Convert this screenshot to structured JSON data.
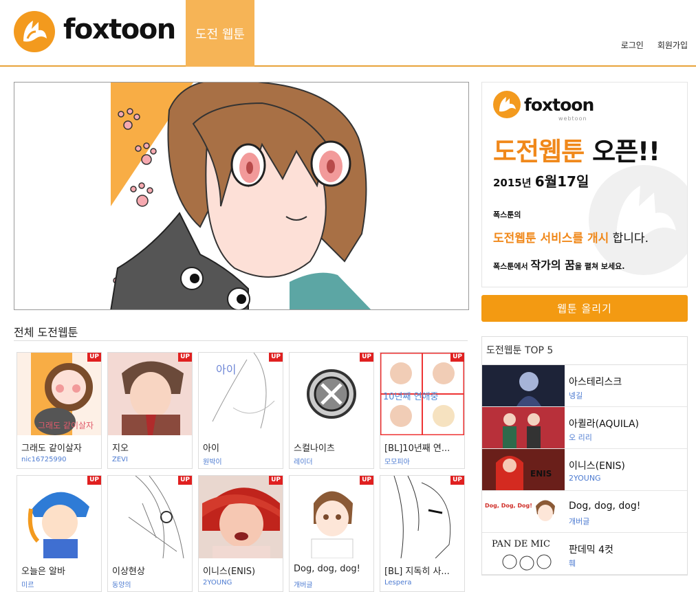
{
  "header": {
    "logo_text": "foxtoon",
    "nav_tab": "도전 웹툰",
    "login": "로그인",
    "signup": "회원가입"
  },
  "section_title": "전체 도전웹툰",
  "up_badge": "UP",
  "webtoons": [
    {
      "title": "그래도 같이살자",
      "author": "nic16725990",
      "thumb_text": "그래도 같이살자"
    },
    {
      "title": "지오",
      "author": "ZEVI"
    },
    {
      "title": "아이",
      "author": "원박이",
      "thumb_text": "아이"
    },
    {
      "title": "스컬나이츠",
      "author": "레이더"
    },
    {
      "title": "[BL]10년째 연...",
      "author": "모모피아",
      "thumb_text": "10년째 연애중"
    },
    {
      "title": "오늘은 알바",
      "author": "미르"
    },
    {
      "title": "이상현상",
      "author": "동양의"
    },
    {
      "title": "이니스(ENIS)",
      "author": "2YOUNG"
    },
    {
      "title": "Dog, dog, dog!",
      "author": "개버글"
    },
    {
      "title": "[BL] 지독히 사...",
      "author": "Lespera"
    }
  ],
  "promo": {
    "logo_text": "foxtoon",
    "logo_sub": "webtoon",
    "headline_orange": "도전웹툰",
    "headline_black": "오픈!!",
    "date_year": "2015년",
    "date_day": "6월17일",
    "line1": "폭스툰의",
    "line2_orange": "도전웹툰 서비스를 개시",
    "line2_black": "합니다.",
    "line3_a": "폭스툰에서",
    "line3_b": "작가의 꿈",
    "line3_c": "을 펼쳐 보세요."
  },
  "upload_button": "웹툰 올리기",
  "top5": {
    "title": "도전웹툰 TOP 5",
    "items": [
      {
        "title": "아스테리스크",
        "author": "넹길"
      },
      {
        "title": "아퀼라(AQUILA)",
        "author": "오 리리"
      },
      {
        "title": "이니스(ENIS)",
        "author": "2YOUNG"
      },
      {
        "title": "Dog, dog, dog!",
        "author": "개버글",
        "thumb_text": "Dog, Dog, Dog!"
      },
      {
        "title": "판데믹 4컷",
        "author": "훼",
        "thumb_text": "PAN DE MIC"
      }
    ]
  },
  "colors": {
    "brand_orange": "#f39a12",
    "tab_orange": "#f6b456",
    "up_red": "#e02020",
    "author_blue": "#4d7bd1"
  }
}
